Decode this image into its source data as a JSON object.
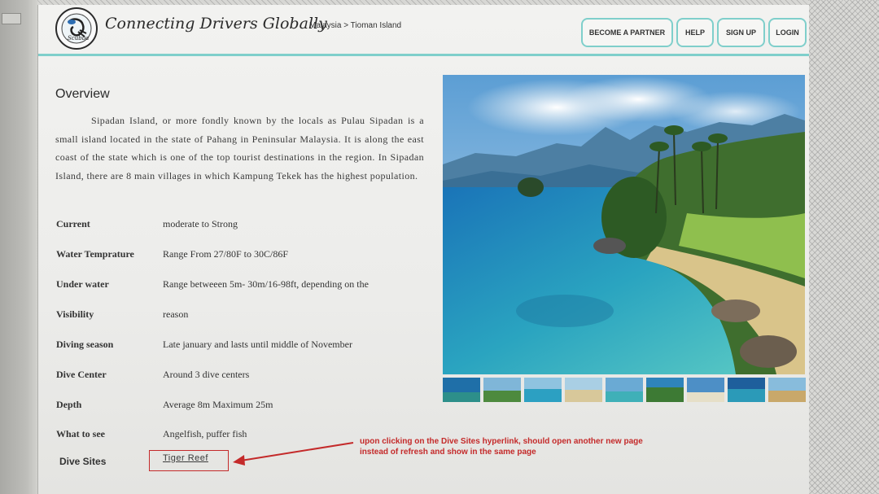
{
  "header": {
    "logo_word": "Scubba",
    "tagline": "Connecting Drivers Globally",
    "breadcrumb": "Malaysia > Tioman Island",
    "nav": {
      "become_partner": "BECOME A PARTNER",
      "help": "HELP",
      "sign_up": "SIGN UP",
      "login": "LOGIN"
    },
    "accent_color": "#7fcfcb"
  },
  "overview": {
    "title": "Overview",
    "text": "Sipadan Island, or more fondly known by the locals as Pulau Sipadan is a small island located in the state of Pahang in Peninsular Malaysia. It is along the east coast of the state which is one of the top tourist destinations in the region. In Sipadan Island, there are 8 main villages in which Kampung Tekek has the highest population."
  },
  "details": [
    {
      "label": "Current",
      "value": "moderate to Strong"
    },
    {
      "label": "Water Temprature",
      "value": "Range From 27/80F to 30C/86F"
    },
    {
      "label": "Under water",
      "value": "Range betweeen 5m- 30m/16-98ft, depending on the"
    },
    {
      "label": "Visibility",
      "value": "reason"
    },
    {
      "label": "Diving season",
      "value": "Late january and lasts until middle of November"
    },
    {
      "label": "Dive Center",
      "value": "Around 3 dive centers"
    },
    {
      "label": "Depth",
      "value": "Average 8m Maximum 25m"
    },
    {
      "label": "What to see",
      "value": "Angelfish, puffer fish"
    }
  ],
  "dive_sites": {
    "label": "Dive Sites",
    "link": "Tiger Reef"
  },
  "annotation": {
    "line1": "upon clicking on the Dive Sites hyperlink, should open another new page",
    "line2": "instead of refresh and show in the same page",
    "color": "#c42a2a"
  },
  "gallery": {
    "main_image": "tropical-island-beach-photo",
    "thumbnail_count": 9
  }
}
